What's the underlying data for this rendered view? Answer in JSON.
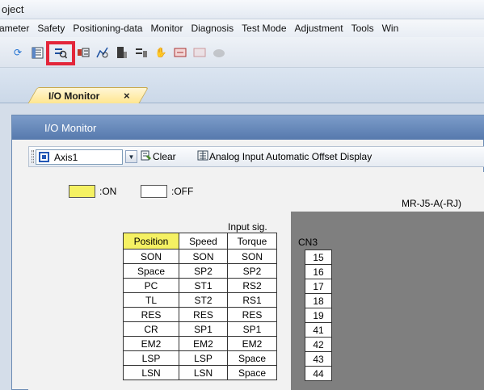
{
  "window_title": "oject",
  "menu": [
    "ameter",
    "Safety",
    "Positioning-data",
    "Monitor",
    "Diagnosis",
    "Test Mode",
    "Adjustment",
    "Tools",
    "Win"
  ],
  "toolbar_icons": [
    "refresh-icon",
    "parameter-list-icon",
    "io-monitor-icon",
    "io-signal-icon",
    "graph-icon",
    "device-icon",
    "test-mode-icon",
    "jog-hand-icon",
    "positioning-icon",
    "program-icon",
    "disabled-tool-icon"
  ],
  "tab": {
    "label": "I/O Monitor",
    "close": "×"
  },
  "panel": {
    "title": "I/O Monitor",
    "axis": "Axis1",
    "clear_label": "Clear",
    "analog_label": "Analog Input Automatic Offset Display"
  },
  "legend": {
    "on": ":ON",
    "off": ":OFF"
  },
  "model": "MR-J5-A(-RJ)",
  "input_sig_label": "Input sig.",
  "connector": "CN3",
  "columns": [
    "Position",
    "Speed",
    "Torque"
  ],
  "active_column": "Position",
  "rows": [
    [
      "SON",
      "SON",
      "SON"
    ],
    [
      "Space",
      "SP2",
      "SP2"
    ],
    [
      "PC",
      "ST1",
      "RS2"
    ],
    [
      "TL",
      "ST2",
      "RS1"
    ],
    [
      "RES",
      "RES",
      "RES"
    ],
    [
      "CR",
      "SP1",
      "SP1"
    ],
    [
      "EM2",
      "EM2",
      "EM2"
    ],
    [
      "LSP",
      "LSP",
      "Space"
    ],
    [
      "LSN",
      "LSN",
      "Space"
    ]
  ],
  "pins": [
    "15",
    "16",
    "17",
    "18",
    "19",
    "41",
    "42",
    "43",
    "44"
  ],
  "colors": {
    "on": "#f5f163",
    "off": "#ffffff",
    "highlight": "#e3263a"
  }
}
